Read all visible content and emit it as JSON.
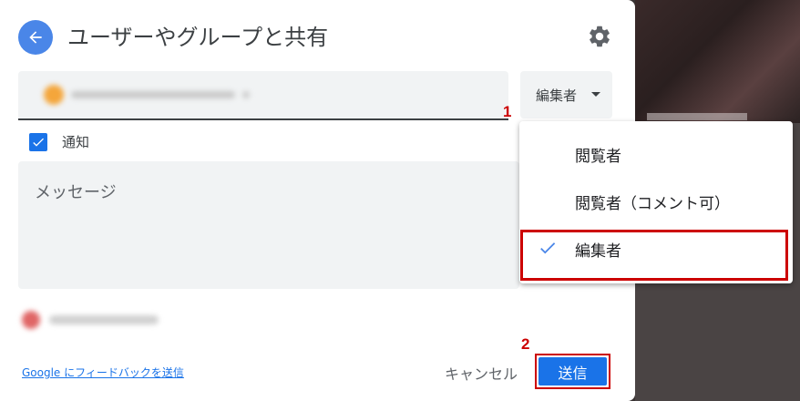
{
  "header": {
    "title": "ユーザーやグループと共有"
  },
  "recipient": {
    "role_label": "編集者"
  },
  "notify": {
    "label": "通知",
    "checked": true
  },
  "message": {
    "placeholder": "メッセージ"
  },
  "footer": {
    "feedback_link": "Google にフィードバックを送信",
    "cancel_label": "キャンセル",
    "send_label": "送信"
  },
  "role_menu": {
    "items": [
      {
        "label": "閲覧者",
        "selected": false
      },
      {
        "label": "閲覧者（コメント可）",
        "selected": false
      },
      {
        "label": "編集者",
        "selected": true
      }
    ]
  },
  "annotations": {
    "step1": "1",
    "step2": "2"
  },
  "colors": {
    "accent": "#1a73e8",
    "annotation": "#cc0000"
  }
}
